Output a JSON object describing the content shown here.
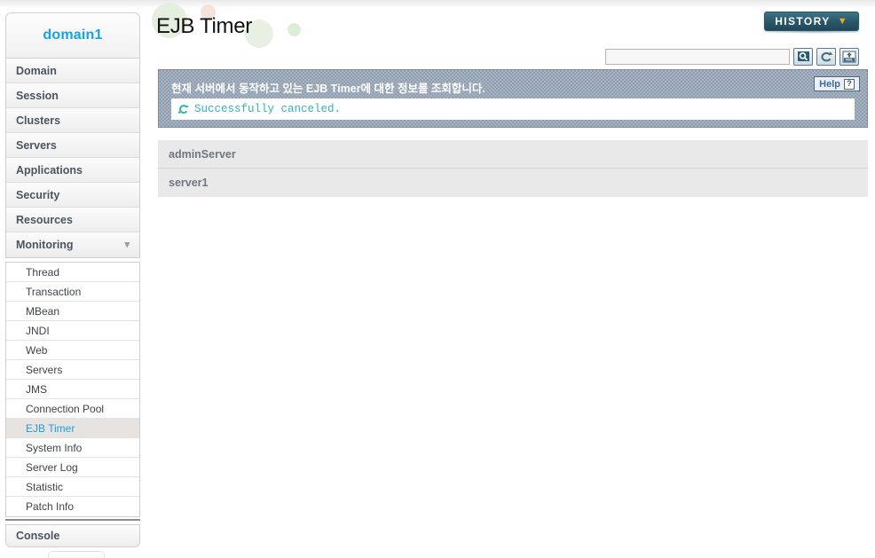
{
  "sidebar": {
    "domain_label": "domain1",
    "top_items": [
      {
        "label": "Domain"
      },
      {
        "label": "Session"
      },
      {
        "label": "Clusters"
      },
      {
        "label": "Servers"
      },
      {
        "label": "Applications"
      },
      {
        "label": "Security"
      },
      {
        "label": "Resources"
      },
      {
        "label": "Monitoring",
        "expanded": true,
        "chevron": "chevron-down-icon"
      }
    ],
    "monitoring_sub_items": [
      {
        "label": "Thread"
      },
      {
        "label": "Transaction"
      },
      {
        "label": "MBean"
      },
      {
        "label": "JNDI"
      },
      {
        "label": "Web"
      },
      {
        "label": "Servers"
      },
      {
        "label": "JMS"
      },
      {
        "label": "Connection Pool"
      },
      {
        "label": "EJB Timer",
        "active": true
      },
      {
        "label": "System Info"
      },
      {
        "label": "Server Log"
      },
      {
        "label": "Statistic"
      },
      {
        "label": "Patch Info"
      }
    ],
    "console_label": "Console"
  },
  "header": {
    "page_title": "EJB Timer",
    "history_label": "HISTORY",
    "history_chevron": "chevron-down-icon"
  },
  "toolbar": {
    "search_value": "",
    "search_placeholder": "",
    "buttons": [
      {
        "name": "search-icon",
        "title": "Search"
      },
      {
        "name": "refresh-icon",
        "title": "Refresh"
      },
      {
        "name": "xml-export-icon",
        "title": "XML"
      }
    ]
  },
  "info_panel": {
    "description": "현재 서버에서 동작하고 있는 EJB Timer에 대한 정보를 조회합니다.",
    "help_label": "Help",
    "help_mark": "?",
    "message": "Successfully canceled.",
    "message_icon": "sync-circle-icon"
  },
  "server_list": {
    "rows": [
      {
        "name": "adminServer"
      },
      {
        "name": "server1"
      }
    ]
  },
  "colors": {
    "domain_blue": "#16a2e8",
    "active_item_blue": "#1a9fe0",
    "history_teal": "#2b5a6c",
    "history_chevron_orange": "#f5a623",
    "info_panel_blue_gray": "#8f9eb0",
    "success_teal": "#36b3ab",
    "row_gray": "#e9e9e9",
    "nav_text": "#4a5560"
  }
}
